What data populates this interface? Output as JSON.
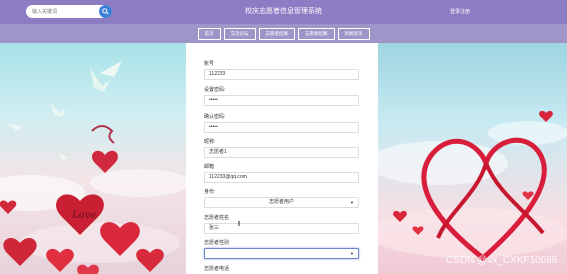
{
  "header": {
    "search_placeholder": "输入关键词",
    "title": "校庆志愿者信息管理系统",
    "login_register": "登录注册"
  },
  "nav": {
    "items": [
      "首页",
      "交流论坛",
      "志愿者招募",
      "志愿者招募",
      "新闻资讯"
    ]
  },
  "form": {
    "fields": [
      {
        "label": "账号",
        "value": "112233"
      },
      {
        "label": "设置密码:",
        "value": "•••••"
      },
      {
        "label": "确认密码:",
        "value": "•••••"
      },
      {
        "label": "昵称:",
        "value": "志愿者1"
      },
      {
        "label": "邮箱",
        "value": "112233@qq.com"
      },
      {
        "label": "身份:",
        "value": "志愿者用户"
      },
      {
        "label": "志愿者姓名",
        "value": "张三"
      },
      {
        "label": "志愿者性别",
        "value": ""
      },
      {
        "label": "志愿者电话",
        "value": ""
      }
    ]
  },
  "watermark": "CSDN @vx_CXKF10088",
  "colors": {
    "header_bg": "#8c7cc3",
    "nav_bg": "#9f95c9",
    "search_button": "#3d7fd6"
  }
}
